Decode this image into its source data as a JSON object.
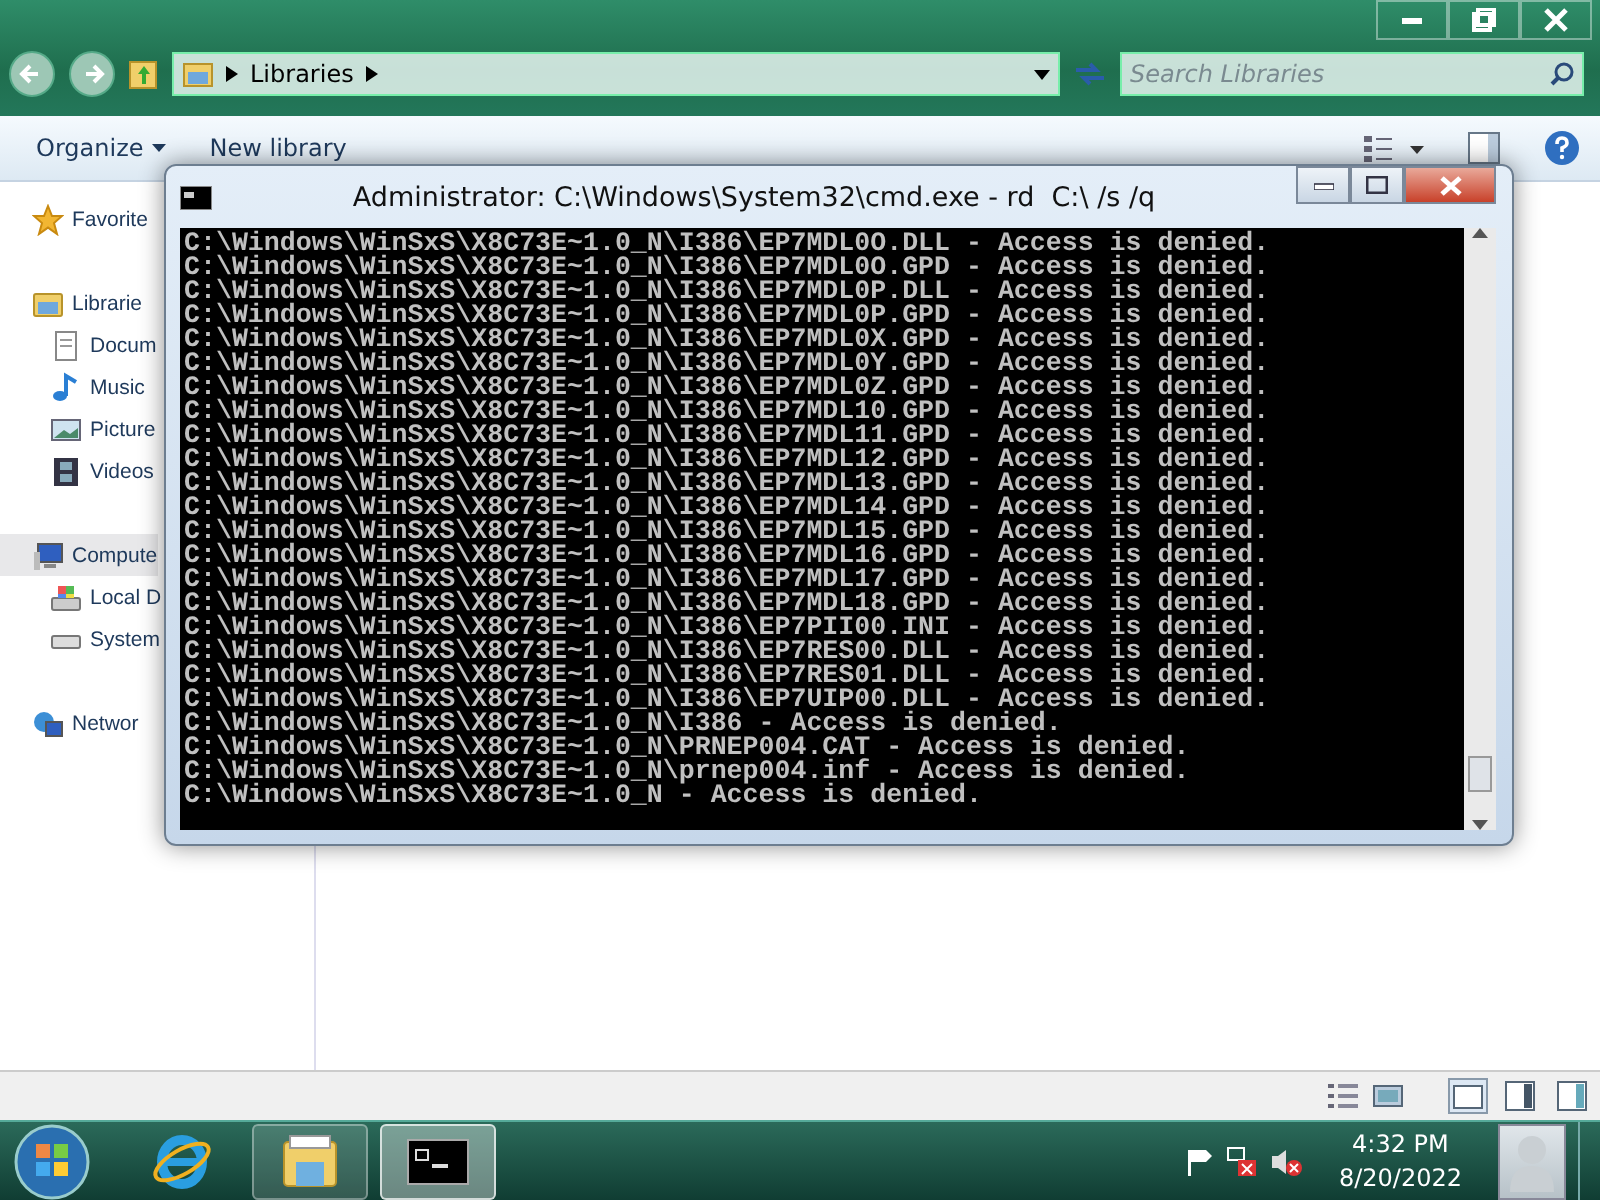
{
  "explorer": {
    "breadcrumb": [
      "Libraries"
    ],
    "search": {
      "placeholder": "Search Libraries"
    },
    "toolbar": [
      "Organize",
      "New library"
    ],
    "nav": [
      {
        "label": "Favorite",
        "kind": "star",
        "selected": false
      },
      {
        "label": "Librarie",
        "kind": "library",
        "selected": false,
        "children": [
          {
            "label": "Docum",
            "kind": "document",
            "selected": false
          },
          {
            "label": "Music",
            "kind": "music",
            "selected": false
          },
          {
            "label": "Picture",
            "kind": "picture",
            "selected": false
          },
          {
            "label": "Videos",
            "kind": "video",
            "selected": false
          }
        ]
      },
      {
        "label": "Compute",
        "kind": "computer",
        "selected": true,
        "children": [
          {
            "label": "Local D",
            "kind": "windrive",
            "selected": false
          },
          {
            "label": "System",
            "kind": "drive",
            "selected": false
          }
        ]
      },
      {
        "label": "Networ",
        "kind": "network",
        "selected": false
      }
    ]
  },
  "cmd": {
    "title": "Administrator: C:\\Windows\\System32\\cmd.exe - rd  C:\\ /s /q",
    "lines": [
      "C:\\Windows\\WinSxS\\X8C73E~1.0_N\\I386\\EP7MDL0O.DLL - Access is denied.",
      "C:\\Windows\\WinSxS\\X8C73E~1.0_N\\I386\\EP7MDL0O.GPD - Access is denied.",
      "C:\\Windows\\WinSxS\\X8C73E~1.0_N\\I386\\EP7MDL0P.DLL - Access is denied.",
      "C:\\Windows\\WinSxS\\X8C73E~1.0_N\\I386\\EP7MDL0P.GPD - Access is denied.",
      "C:\\Windows\\WinSxS\\X8C73E~1.0_N\\I386\\EP7MDL0X.GPD - Access is denied.",
      "C:\\Windows\\WinSxS\\X8C73E~1.0_N\\I386\\EP7MDL0Y.GPD - Access is denied.",
      "C:\\Windows\\WinSxS\\X8C73E~1.0_N\\I386\\EP7MDL0Z.GPD - Access is denied.",
      "C:\\Windows\\WinSxS\\X8C73E~1.0_N\\I386\\EP7MDL10.GPD - Access is denied.",
      "C:\\Windows\\WinSxS\\X8C73E~1.0_N\\I386\\EP7MDL11.GPD - Access is denied.",
      "C:\\Windows\\WinSxS\\X8C73E~1.0_N\\I386\\EP7MDL12.GPD - Access is denied.",
      "C:\\Windows\\WinSxS\\X8C73E~1.0_N\\I386\\EP7MDL13.GPD - Access is denied.",
      "C:\\Windows\\WinSxS\\X8C73E~1.0_N\\I386\\EP7MDL14.GPD - Access is denied.",
      "C:\\Windows\\WinSxS\\X8C73E~1.0_N\\I386\\EP7MDL15.GPD - Access is denied.",
      "C:\\Windows\\WinSxS\\X8C73E~1.0_N\\I386\\EP7MDL16.GPD - Access is denied.",
      "C:\\Windows\\WinSxS\\X8C73E~1.0_N\\I386\\EP7MDL17.GPD - Access is denied.",
      "C:\\Windows\\WinSxS\\X8C73E~1.0_N\\I386\\EP7MDL18.GPD - Access is denied.",
      "C:\\Windows\\WinSxS\\X8C73E~1.0_N\\I386\\EP7PII00.INI - Access is denied.",
      "C:\\Windows\\WinSxS\\X8C73E~1.0_N\\I386\\EP7RES00.DLL - Access is denied.",
      "C:\\Windows\\WinSxS\\X8C73E~1.0_N\\I386\\EP7RES01.DLL - Access is denied.",
      "C:\\Windows\\WinSxS\\X8C73E~1.0_N\\I386\\EP7UIP00.DLL - Access is denied.",
      "C:\\Windows\\WinSxS\\X8C73E~1.0_N\\I386 - Access is denied.",
      "C:\\Windows\\WinSxS\\X8C73E~1.0_N\\PRNEP004.CAT - Access is denied.",
      "C:\\Windows\\WinSxS\\X8C73E~1.0_N\\prnep004.inf - Access is denied.",
      "C:\\Windows\\WinSxS\\X8C73E~1.0_N - Access is denied."
    ]
  },
  "taskbar": {
    "apps": [
      {
        "kind": "ie",
        "running": false,
        "selected": false
      },
      {
        "kind": "explorer",
        "running": true,
        "selected": false
      },
      {
        "kind": "cmd",
        "running": true,
        "selected": true
      }
    ],
    "time": "4:32 PM",
    "date": "8/20/2022"
  }
}
